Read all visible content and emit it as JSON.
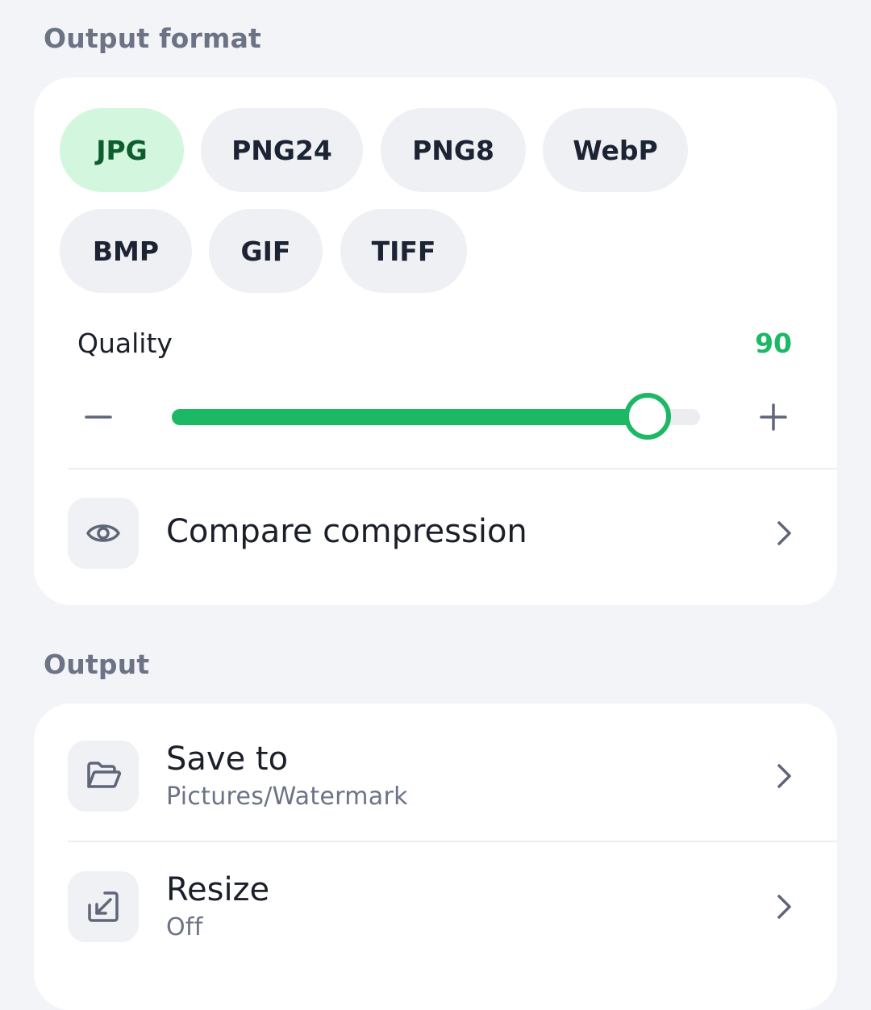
{
  "format_section": {
    "label": "Output format",
    "chips": [
      {
        "label": "JPG",
        "selected": true
      },
      {
        "label": "PNG24",
        "selected": false
      },
      {
        "label": "PNG8",
        "selected": false
      },
      {
        "label": "WebP",
        "selected": false
      },
      {
        "label": "BMP",
        "selected": false
      },
      {
        "label": "GIF",
        "selected": false
      },
      {
        "label": "TIFF",
        "selected": false
      }
    ],
    "quality": {
      "label": "Quality",
      "value": "90",
      "fill_fraction": 0.9
    },
    "compare": {
      "label": "Compare compression",
      "icon": "eye-icon"
    }
  },
  "output_section": {
    "label": "Output",
    "save_to": {
      "title": "Save to",
      "subtitle": "Pictures/Watermark",
      "icon": "folder-open-icon"
    },
    "resize": {
      "title": "Resize",
      "subtitle": "Off",
      "icon": "resize-icon"
    }
  },
  "colors": {
    "accent": "#1db866",
    "selected_chip_bg": "#d3f7de",
    "background": "#f3f4f7"
  }
}
